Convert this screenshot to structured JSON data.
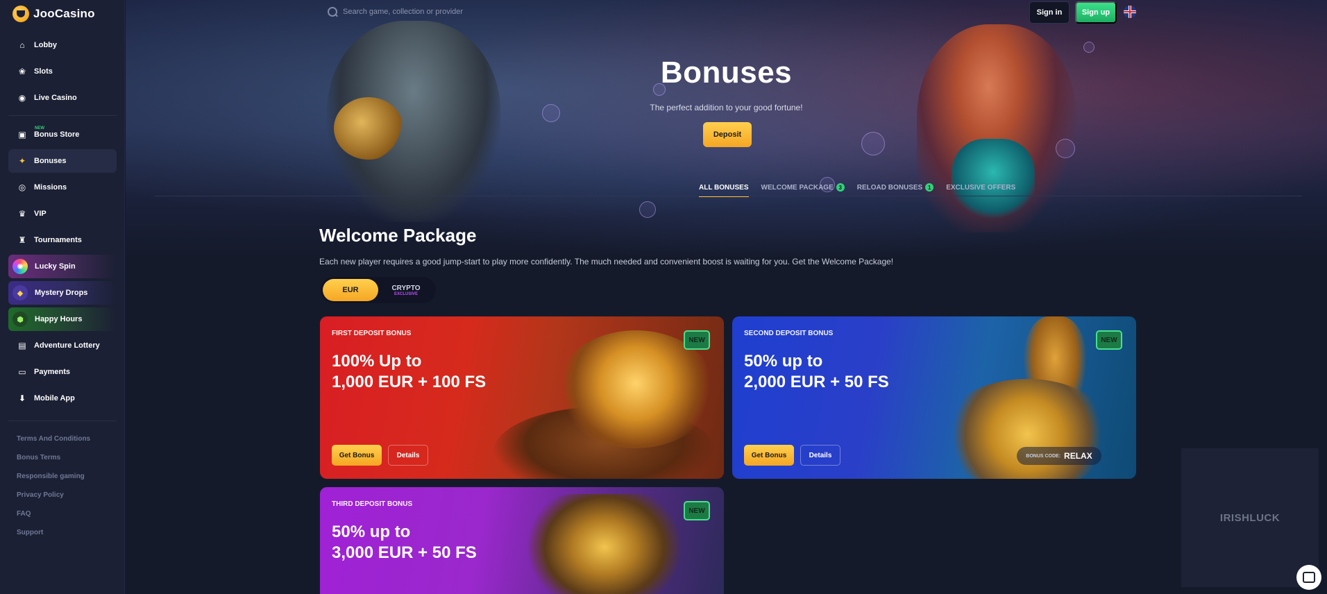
{
  "brand": {
    "name": "JooCasino"
  },
  "sidebar": {
    "items": [
      {
        "label": "Lobby",
        "icon": "home-icon",
        "glyph": "⌂"
      },
      {
        "label": "Slots",
        "icon": "slots-icon",
        "glyph": "❀"
      },
      {
        "label": "Live Casino",
        "icon": "live-casino-icon",
        "glyph": "◉"
      },
      {
        "label": "Bonus Store",
        "icon": "bag-icon",
        "glyph": "▣",
        "tag": "NEW"
      },
      {
        "label": "Bonuses",
        "icon": "gift-icon",
        "glyph": "✦"
      },
      {
        "label": "Missions",
        "icon": "target-icon",
        "glyph": "◎"
      },
      {
        "label": "VIP",
        "icon": "crown-icon",
        "glyph": "♛"
      },
      {
        "label": "Tournaments",
        "icon": "trophy-icon",
        "glyph": "♜"
      },
      {
        "label": "Lucky Spin",
        "icon": "wheel-icon",
        "glyph": "✺"
      },
      {
        "label": "Mystery Drops",
        "icon": "drops-icon",
        "glyph": "◆"
      },
      {
        "label": "Happy Hours",
        "icon": "hourglass-icon",
        "glyph": "⬢"
      },
      {
        "label": "Adventure Lottery",
        "icon": "ticket-icon",
        "glyph": "▤"
      },
      {
        "label": "Payments",
        "icon": "card-icon",
        "glyph": "▭"
      },
      {
        "label": "Mobile App",
        "icon": "download-icon",
        "glyph": "⬇"
      }
    ],
    "footer_links": [
      "Terms And Conditions",
      "Bonus Terms",
      "Responsible gaming",
      "Privacy Policy",
      "FAQ",
      "Support"
    ]
  },
  "topbar": {
    "search_placeholder": "Search game, collection or provider",
    "signin_label": "Sign in",
    "signup_label": "Sign up",
    "language": "English (UK flag)"
  },
  "hero": {
    "title": "Bonuses",
    "subtitle": "The perfect addition to your good fortune!",
    "deposit_label": "Deposit"
  },
  "tabs": [
    {
      "label": "ALL BONUSES",
      "active": true
    },
    {
      "label": "WELCOME PACKAGE",
      "count": "3"
    },
    {
      "label": "RELOAD BONUSES",
      "count": "1"
    },
    {
      "label": "EXCLUSIVE OFFERS"
    }
  ],
  "welcome": {
    "title": "Welcome Package",
    "description": "Each new player requires a good jump-start to play more confidently. The much needed and convenient boost is waiting for you. Get the Welcome Package!",
    "toggle": {
      "eur": "EUR",
      "crypto": "CRYPTO",
      "crypto_tag": "EXCLUSIVE"
    }
  },
  "cards": [
    {
      "label": "FIRST DEPOSIT BONUS",
      "offer_line1": "100% Up to",
      "offer_line2": "1,000 EUR + 100 FS",
      "badge": "NEW",
      "get": "Get Bonus",
      "details": "Details"
    },
    {
      "label": "SECOND DEPOSIT BONUS",
      "offer_line1": "50% up to",
      "offer_line2": "2,000 EUR + 50 FS",
      "badge": "NEW",
      "get": "Get Bonus",
      "details": "Details",
      "code_label": "BONUS CODE:",
      "code": "RELAX"
    },
    {
      "label": "THIRD DEPOSIT BONUS",
      "offer_line1": "50% up to",
      "offer_line2": "3,000 EUR + 50 FS",
      "badge": "NEW"
    }
  ],
  "promo_tile": {
    "text": "IRISHLUCK"
  },
  "colors": {
    "accent": "#ffc33a",
    "signup": "#31d17b",
    "background": "#151a2b",
    "sidebar": "#1b2034"
  }
}
